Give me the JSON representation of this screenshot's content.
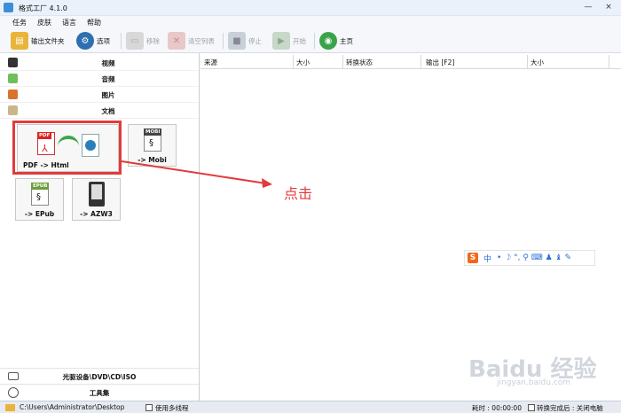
{
  "window": {
    "title": "格式工厂 4.1.0",
    "minimize": "—",
    "close": "×"
  },
  "menu": [
    "任务",
    "皮肤",
    "语言",
    "帮助"
  ],
  "toolbar": {
    "output_folder": "输出文件夹",
    "options": "选项",
    "remove": "移除",
    "clear_list": "清空列表",
    "stop": "停止",
    "start": "开始",
    "home": "主页"
  },
  "categories": [
    "视频",
    "音频",
    "图片",
    "文档"
  ],
  "tiles": {
    "pdf_html": "PDF -> Html",
    "mobi": "-> Mobi",
    "epub": "-> EPub",
    "azw3": "-> AZW3",
    "pdf_tag": "PDF",
    "mobi_tag": "MOBI",
    "epub_tag": "EPUB"
  },
  "bottom": {
    "optical": "光驱设备\\DVD\\CD\\ISO",
    "tools": "工具集"
  },
  "grid_headers": [
    "来源",
    "大小",
    "转换状态",
    "输出 [F2]",
    "大小"
  ],
  "annotation": "点击",
  "ime": {
    "logo": "S",
    "lang": "中",
    "extra": "• ☽ °, ⚲ ⌨ ♟ ♝ ✎"
  },
  "watermark": {
    "text": "Baidu 经验",
    "sub": "jingyan.baidu.com"
  },
  "status": {
    "path": "C:\\Users\\Administrator\\Desktop",
    "multithread": "使用多线程",
    "elapsed": "耗时 : 00:00:00",
    "after": "转换完成后 : 关闭电脑"
  }
}
